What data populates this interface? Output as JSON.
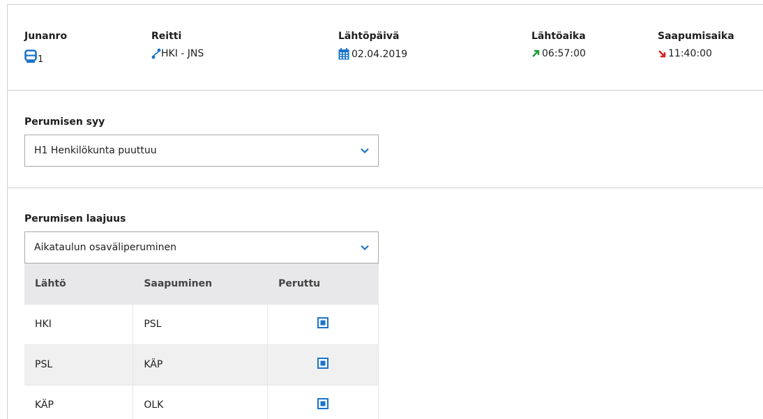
{
  "header": {
    "train_no": {
      "label": "Junanro",
      "value": "1",
      "icon": "train-icon"
    },
    "route": {
      "label": "Reitti",
      "value": "HKI - JNS",
      "icon": "route-icon"
    },
    "departure_date": {
      "label": "Lähtöpäivä",
      "value": "02.04.2019",
      "icon": "calendar-icon"
    },
    "departure_time": {
      "label": "Lähtöaika",
      "value": "06:57:00",
      "icon": "arrow-up-right-icon"
    },
    "arrival_time": {
      "label": "Saapumisaika",
      "value": "11:40:00",
      "icon": "arrow-down-right-icon"
    }
  },
  "cancel_reason": {
    "label": "Perumisen syy",
    "selected": "H1 Henkilökunta puuttuu"
  },
  "cancel_scope": {
    "label": "Perumisen laajuus",
    "selected": "Aikataulun osaväliperuminen",
    "table": {
      "headers": [
        "Lähtö",
        "Saapuminen",
        "Peruttu"
      ],
      "rows": [
        {
          "from": "HKI",
          "to": "PSL",
          "cancelled": true
        },
        {
          "from": "PSL",
          "to": "KÄP",
          "cancelled": true
        },
        {
          "from": "KÄP",
          "to": "OLK",
          "cancelled": true
        }
      ]
    }
  },
  "colors": {
    "accent": "#1a73c8",
    "green": "#1e9b3a",
    "red": "#d61f1f"
  }
}
